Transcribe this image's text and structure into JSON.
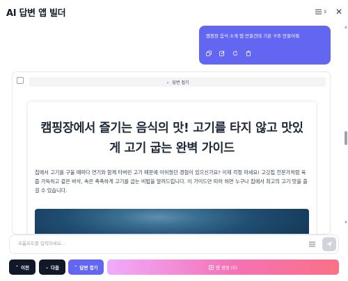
{
  "header": {
    "title": "AI 답변 앱 빌더",
    "count": "3",
    "menu_icon": "list-icon",
    "close_icon": "close-icon"
  },
  "user_message": {
    "text": "캠핑장 음식 소개 앱 만들건데 기본 구조 만들어줘",
    "actions": [
      "copy-icon",
      "edit-icon",
      "refresh-icon",
      "trash-icon"
    ]
  },
  "answer": {
    "collapse_label": "답변 접기",
    "doc": {
      "title": "캠핑장에서 즐기는 음식의 맛! 고기를 타지 않고 맛있게 고기 굽는 완벽 가이드",
      "body": "집에서 고기를 구울 때마다 연기와 함께 타버린 고기 때문에 아쉬웠던 경험이 있으신가요? 이제 걱정 마세요! 고깃집 전문가처럼 육즙 가득하고 겉은 바삭, 속은 촉촉하게 고기를 굽는 비법을 알려드립니다. 이 가이드만 따라 하면 누구나 집에서 최고의 고기 맛을 즐길 수 있습니다."
    }
  },
  "prompt": {
    "placeholder": "프롬프트를 입력하세요...",
    "value": ""
  },
  "footer": {
    "prev_label": "이전",
    "next_label": "다음",
    "fold_label": "답변 접기",
    "make_label": "앱 생성 (0)"
  },
  "colors": {
    "accent": "#6366f1",
    "dark_button": "#111827",
    "make_gradient_start": "#f0abfc",
    "make_gradient_end": "#fb7185"
  }
}
